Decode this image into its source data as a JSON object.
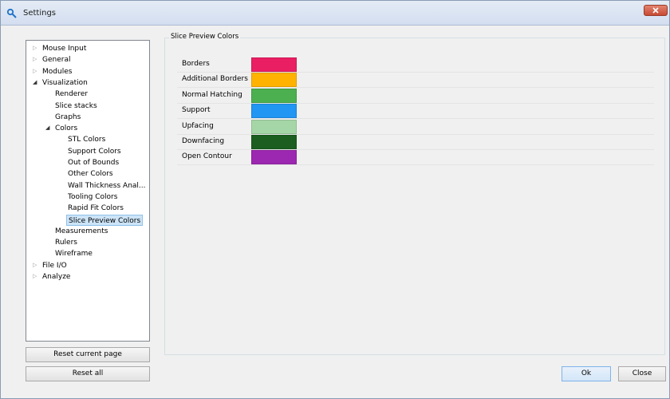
{
  "window": {
    "title": "Settings"
  },
  "tree": [
    {
      "label": "Mouse Input",
      "level": 0,
      "arrow": "collapsed"
    },
    {
      "label": "General",
      "level": 0,
      "arrow": "collapsed"
    },
    {
      "label": "Modules",
      "level": 0,
      "arrow": "collapsed"
    },
    {
      "label": "Visualization",
      "level": 0,
      "arrow": "expanded"
    },
    {
      "label": "Renderer",
      "level": 1,
      "arrow": "none"
    },
    {
      "label": "Slice stacks",
      "level": 1,
      "arrow": "none"
    },
    {
      "label": "Graphs",
      "level": 1,
      "arrow": "none"
    },
    {
      "label": "Colors",
      "level": 1,
      "arrow": "expanded"
    },
    {
      "label": "STL Colors",
      "level": 2,
      "arrow": "none"
    },
    {
      "label": "Support Colors",
      "level": 2,
      "arrow": "none"
    },
    {
      "label": "Out of Bounds",
      "level": 2,
      "arrow": "none"
    },
    {
      "label": "Other Colors",
      "level": 2,
      "arrow": "none"
    },
    {
      "label": "Wall Thickness Anal...",
      "level": 2,
      "arrow": "none"
    },
    {
      "label": "Tooling Colors",
      "level": 2,
      "arrow": "none"
    },
    {
      "label": "Rapid Fit Colors",
      "level": 2,
      "arrow": "none"
    },
    {
      "label": "Slice Preview Colors",
      "level": 2,
      "arrow": "none",
      "selected": true
    },
    {
      "label": "Measurements",
      "level": 1,
      "arrow": "none"
    },
    {
      "label": "Rulers",
      "level": 1,
      "arrow": "none"
    },
    {
      "label": "Wireframe",
      "level": 1,
      "arrow": "none"
    },
    {
      "label": "File I/O",
      "level": 0,
      "arrow": "collapsed"
    },
    {
      "label": "Analyze",
      "level": 0,
      "arrow": "collapsed"
    }
  ],
  "buttons": {
    "reset_current_page": "Reset current page",
    "reset_all": "Reset all",
    "ok": "Ok",
    "close": "Close"
  },
  "panel": {
    "title": "Slice Preview Colors",
    "rows": [
      {
        "label": "Borders",
        "color": "#e91e63"
      },
      {
        "label": "Additional Borders",
        "color": "#ffb300"
      },
      {
        "label": "Normal Hatching",
        "color": "#4caf50"
      },
      {
        "label": "Support",
        "color": "#2196f3"
      },
      {
        "label": "Upfacing",
        "color": "#a5d6a7"
      },
      {
        "label": "Downfacing",
        "color": "#1b5e20"
      },
      {
        "label": "Open Contour",
        "color": "#9c27b0"
      }
    ]
  }
}
